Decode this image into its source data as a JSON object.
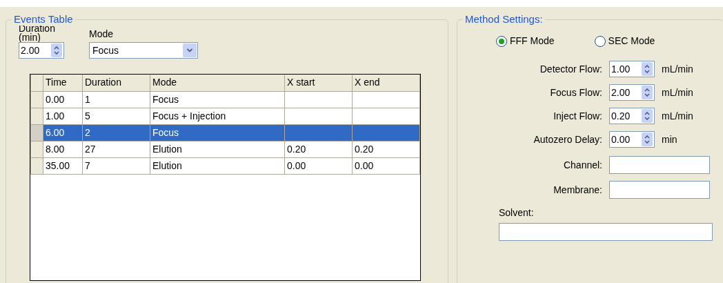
{
  "events_table": {
    "title": "Events Table",
    "duration_field": {
      "label": "Duration (min)",
      "value": "2.00"
    },
    "mode_field": {
      "label": "Mode",
      "value": "Focus"
    },
    "table": {
      "columns": [
        "Time",
        "Duration",
        "Mode",
        "X start",
        "X end"
      ],
      "rows": [
        {
          "cells": [
            "0.00",
            "1",
            "Focus",
            "",
            ""
          ],
          "selected": false
        },
        {
          "cells": [
            "1.00",
            "5",
            "Focus + Injection",
            "",
            ""
          ],
          "selected": false
        },
        {
          "cells": [
            "6.00",
            "2",
            "Focus",
            "",
            ""
          ],
          "selected": true
        },
        {
          "cells": [
            "8.00",
            "27",
            "Elution",
            "0.20",
            "0.20"
          ],
          "selected": false
        },
        {
          "cells": [
            "35.00",
            "7",
            "Elution",
            "0.00",
            "0.00"
          ],
          "selected": false
        }
      ]
    }
  },
  "method_settings": {
    "title": "Method Settings:",
    "modes": [
      {
        "label": "FFF Mode",
        "selected": true
      },
      {
        "label": "SEC Mode",
        "selected": false
      }
    ],
    "fields": [
      {
        "kind": "spin",
        "label": "Detector Flow:",
        "value": "1.00",
        "unit": "mL/min"
      },
      {
        "kind": "spin",
        "label": "Focus Flow:",
        "value": "2.00",
        "unit": "mL/min"
      },
      {
        "kind": "spin",
        "label": "Inject Flow:",
        "value": "0.20",
        "unit": "mL/min"
      },
      {
        "kind": "spin",
        "label": "Autozero Delay:",
        "value": "0.00",
        "unit": "min"
      },
      {
        "kind": "text",
        "label": "Channel:"
      },
      {
        "kind": "text",
        "label": "Membrane:"
      }
    ],
    "solvent": {
      "label": "Solvent:"
    }
  }
}
